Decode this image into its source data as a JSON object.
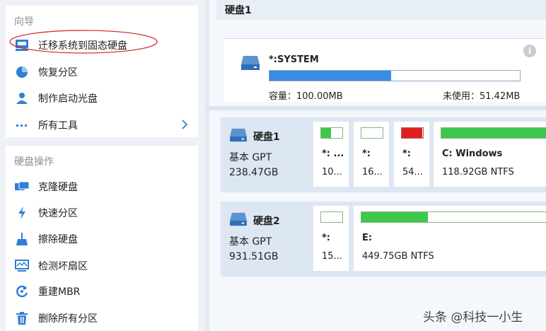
{
  "sidebar": {
    "wizard": {
      "title": "向导",
      "items": [
        {
          "label": "迁移系统到固态硬盘",
          "icon": "migrate-disk-icon"
        },
        {
          "label": "恢复分区",
          "icon": "pie-restore-icon"
        },
        {
          "label": "制作启动光盘",
          "icon": "boot-disc-user-icon"
        },
        {
          "label": "所有工具",
          "icon": "more-dots-icon"
        }
      ]
    },
    "disk_ops": {
      "title": "硬盘操作",
      "items": [
        {
          "label": "克隆硬盘",
          "icon": "clone-disk-icon"
        },
        {
          "label": "快速分区",
          "icon": "lightning-icon"
        },
        {
          "label": "擦除硬盘",
          "icon": "broom-icon"
        },
        {
          "label": "检测坏扇区",
          "icon": "monitor-scan-icon"
        },
        {
          "label": "重建MBR",
          "icon": "rebuild-icon"
        },
        {
          "label": "删除所有分区",
          "icon": "trash-icon"
        }
      ]
    }
  },
  "main": {
    "header_title": "硬盘1",
    "selected_partition": {
      "name": "*:SYSTEM",
      "used_fraction": 0.486,
      "capacity": "容量：100.00MB",
      "unused": "未使用：51.42MB"
    },
    "disks": [
      {
        "name": "硬盘1",
        "type": "基本 GPT",
        "size": "238.47GB",
        "partitions": [
          {
            "letter": "*: ...",
            "size": "10...",
            "fill": 0.45,
            "color": "#3cc84a"
          },
          {
            "letter": "*:",
            "size": "16...",
            "fill": 0.0,
            "color": "#3cc84a"
          },
          {
            "letter": "*:",
            "size": "54...",
            "fill": 0.96,
            "color": "#e02020"
          },
          {
            "letter": "C: Windows",
            "size": "118.92GB NTFS",
            "fill": 1.0,
            "color": "#3cc84a"
          }
        ]
      },
      {
        "name": "硬盘2",
        "type": "基本 GPT",
        "size": "931.51GB",
        "partitions": [
          {
            "letter": "*:",
            "size": "15...",
            "fill": 0.0,
            "color": "#3cc84a"
          },
          {
            "letter": "E:",
            "size": "449.75GB NTFS",
            "fill": 0.36,
            "color": "#3cc84a"
          }
        ]
      }
    ]
  },
  "watermark": "头条 @科技一小生",
  "colors": {
    "accent_blue": "#3b8de3",
    "used_green": "#3cc84a",
    "used_red": "#e02020"
  }
}
